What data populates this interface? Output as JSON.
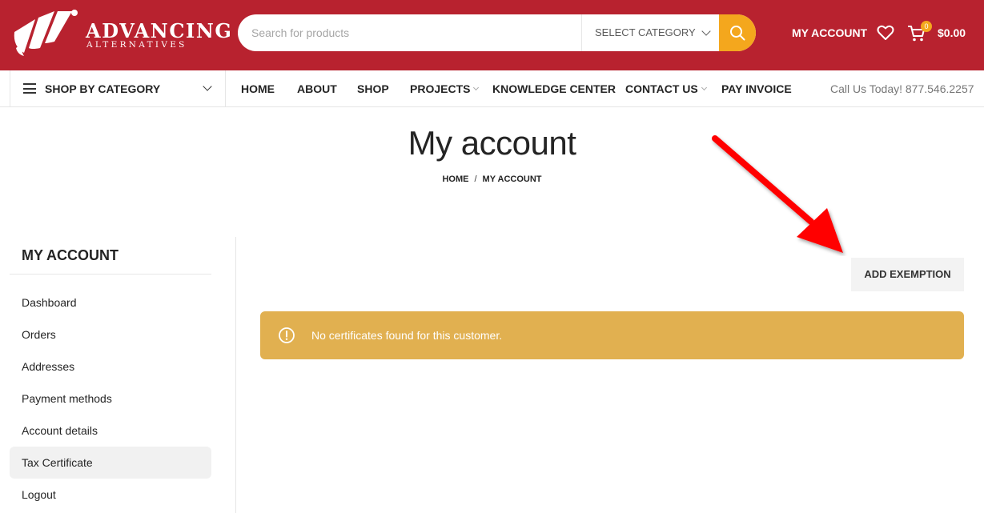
{
  "header": {
    "logo": {
      "name": "ADVANCING",
      "tagline": "ALTERNATIVES"
    },
    "search": {
      "placeholder": "Search for products",
      "category": "SELECT CATEGORY"
    },
    "account_label": "MY ACCOUNT",
    "cart": {
      "count": "0",
      "total": "$0.00"
    }
  },
  "nav": {
    "shop_by_category": "SHOP BY CATEGORY",
    "items": [
      {
        "label": "HOME"
      },
      {
        "label": "ABOUT"
      },
      {
        "label": "SHOP"
      },
      {
        "label": "PROJECTS",
        "has_submenu": true
      },
      {
        "label": "KNOWLEDGE CENTER"
      },
      {
        "label": "CONTACT US",
        "has_submenu": true
      },
      {
        "label": "PAY INVOICE"
      }
    ],
    "phone": "Call Us Today! 877.546.2257"
  },
  "page": {
    "title": "My account",
    "breadcrumb": [
      "HOME",
      "MY ACCOUNT"
    ]
  },
  "sidebar": {
    "title": "MY ACCOUNT",
    "items": [
      {
        "label": "Dashboard",
        "active": false
      },
      {
        "label": "Orders",
        "active": false
      },
      {
        "label": "Addresses",
        "active": false
      },
      {
        "label": "Payment methods",
        "active": false
      },
      {
        "label": "Account details",
        "active": false
      },
      {
        "label": "Tax Certificate",
        "active": true
      },
      {
        "label": "Logout",
        "active": false
      }
    ]
  },
  "main": {
    "add_button": "ADD EXEMPTION",
    "notice": {
      "icon": "info-circle-icon",
      "message": "No certificates found for this customer."
    }
  },
  "colors": {
    "header_bg": "#b8222f",
    "accent": "#f4a71d",
    "notice_bg": "#e1b050",
    "annotation_arrow": "#ff0000"
  }
}
